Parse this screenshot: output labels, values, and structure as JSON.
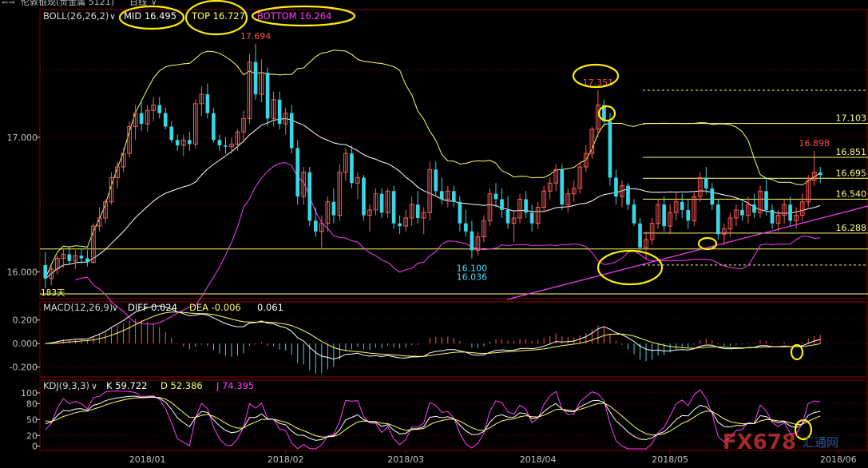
{
  "window": {
    "title": "伦敦银现(贵金属 5121)",
    "timeframe": "日线",
    "dropdown_glyph": "∨"
  },
  "colors": {
    "background": "#000000",
    "up": "#ff5a5a",
    "down": "#39d6e6",
    "price_axis": "#c0c0c0",
    "grid": "#7a0000",
    "mid": "#ffffff",
    "top": "#ffff66",
    "bottom": "#ff3dff",
    "level": "#ffff66",
    "trendline": "#ff3dff",
    "highlight": "#ffee00",
    "label_yellow": "#ffff88",
    "label_cyan": "#3fe0ff",
    "label_red": "#ff4b4b"
  },
  "boll_header": {
    "name": "BOLL(26,26,2)",
    "mid": "MID 16.495",
    "top": "TOP 16.727",
    "bottom": "BOTTOM 16.264"
  },
  "macd_header": {
    "name": "MACD(12,26,9)",
    "diff": "DIFF 0.024",
    "dea": "DEA -0.006",
    "macd": "0.061"
  },
  "kdj_header": {
    "name": "KDJ(9,3,3)",
    "k": "K 59.722",
    "d": "D 52.386",
    "j": "J 74.395"
  },
  "price_axis_ticks": [
    "17.000",
    "16.000"
  ],
  "macd_axis_ticks": [
    "0.200",
    "0.000",
    "-0.200"
  ],
  "kdj_axis_ticks": [
    "100",
    "80",
    "50",
    "20",
    "0"
  ],
  "bottom_left_text": "183天",
  "watermark_text": "FX678",
  "watermark_sub": "汇通网",
  "x_axis_labels": [
    {
      "label": "2018/01",
      "bar": 17
    },
    {
      "label": "2018/02",
      "bar": 40
    },
    {
      "label": "2018/03",
      "bar": 60
    },
    {
      "label": "2018/04",
      "bar": 82
    },
    {
      "label": "2018/05",
      "bar": 104
    },
    {
      "label": "2018/06",
      "bar": 132
    }
  ],
  "annotations": [
    {
      "text": "17.694",
      "color_key": "label_red"
    },
    {
      "text": "17.351",
      "color_key": "label_red"
    },
    {
      "text": "16.898",
      "color_key": "label_red"
    },
    {
      "text": "16.100",
      "color_key": "label_cyan"
    },
    {
      "text": "16.036",
      "color_key": "label_cyan"
    }
  ],
  "chart_data": {
    "type": "candlestick",
    "instrument": "伦敦银现",
    "period": "日线",
    "ylim": [
      15.8,
      17.95
    ],
    "horizontal_levels": [
      {
        "value": 17.103,
        "label": "17.103",
        "style": "solid"
      },
      {
        "value": 16.851,
        "label": "16.851",
        "style": "solid"
      },
      {
        "value": 16.695,
        "label": "16.695",
        "style": "solid"
      },
      {
        "value": 16.54,
        "label": "16.540",
        "style": "solid"
      },
      {
        "value": 16.288,
        "label": "16.288",
        "style": "solid"
      },
      {
        "value": 17.35,
        "label": "",
        "style": "dashed"
      },
      {
        "value": 16.05,
        "label": "",
        "style": "dashed"
      },
      {
        "value": 16.17,
        "label": "",
        "style": "solid_full"
      }
    ],
    "candles": [
      {
        "o": 16.05,
        "h": 16.15,
        "l": 15.88,
        "c": 15.95
      },
      {
        "o": 15.95,
        "h": 16.05,
        "l": 15.9,
        "c": 16.02
      },
      {
        "o": 16.02,
        "h": 16.12,
        "l": 15.98,
        "c": 16.1
      },
      {
        "o": 16.1,
        "h": 16.17,
        "l": 16.03,
        "c": 16.13
      },
      {
        "o": 16.13,
        "h": 16.19,
        "l": 16.05,
        "c": 16.08
      },
      {
        "o": 16.08,
        "h": 16.16,
        "l": 16.02,
        "c": 16.12
      },
      {
        "o": 16.12,
        "h": 16.17,
        "l": 16.06,
        "c": 16.1
      },
      {
        "o": 16.1,
        "h": 16.16,
        "l": 16.04,
        "c": 16.07
      },
      {
        "o": 16.07,
        "h": 16.36,
        "l": 16.06,
        "c": 16.34
      },
      {
        "o": 16.34,
        "h": 16.48,
        "l": 16.3,
        "c": 16.4
      },
      {
        "o": 16.4,
        "h": 16.54,
        "l": 16.36,
        "c": 16.52
      },
      {
        "o": 16.52,
        "h": 16.74,
        "l": 16.5,
        "c": 16.7
      },
      {
        "o": 16.7,
        "h": 16.82,
        "l": 16.62,
        "c": 16.78
      },
      {
        "o": 16.78,
        "h": 16.92,
        "l": 16.74,
        "c": 16.88
      },
      {
        "o": 16.88,
        "h": 17.12,
        "l": 16.85,
        "c": 17.08
      },
      {
        "o": 17.08,
        "h": 17.24,
        "l": 16.98,
        "c": 17.18
      },
      {
        "o": 17.18,
        "h": 17.26,
        "l": 17.05,
        "c": 17.1
      },
      {
        "o": 17.1,
        "h": 17.24,
        "l": 17.04,
        "c": 17.2
      },
      {
        "o": 17.2,
        "h": 17.3,
        "l": 17.12,
        "c": 17.24
      },
      {
        "o": 17.24,
        "h": 17.3,
        "l": 17.14,
        "c": 17.18
      },
      {
        "o": 17.18,
        "h": 17.22,
        "l": 17.06,
        "c": 17.08
      },
      {
        "o": 17.08,
        "h": 17.12,
        "l": 16.96,
        "c": 16.98
      },
      {
        "o": 16.98,
        "h": 17.02,
        "l": 16.9,
        "c": 16.94
      },
      {
        "o": 16.94,
        "h": 17.02,
        "l": 16.86,
        "c": 16.98
      },
      {
        "o": 16.98,
        "h": 17.04,
        "l": 16.9,
        "c": 16.95
      },
      {
        "o": 16.95,
        "h": 17.28,
        "l": 16.92,
        "c": 17.25
      },
      {
        "o": 17.25,
        "h": 17.38,
        "l": 17.16,
        "c": 17.32
      },
      {
        "o": 17.32,
        "h": 17.4,
        "l": 17.14,
        "c": 17.18
      },
      {
        "o": 17.18,
        "h": 17.22,
        "l": 16.96,
        "c": 16.98
      },
      {
        "o": 16.98,
        "h": 17.02,
        "l": 16.9,
        "c": 16.94
      },
      {
        "o": 16.94,
        "h": 17.0,
        "l": 16.88,
        "c": 16.93
      },
      {
        "o": 16.93,
        "h": 17.0,
        "l": 16.88,
        "c": 16.95
      },
      {
        "o": 16.95,
        "h": 17.06,
        "l": 16.9,
        "c": 17.04
      },
      {
        "o": 17.04,
        "h": 17.2,
        "l": 16.96,
        "c": 17.14
      },
      {
        "o": 17.14,
        "h": 17.62,
        "l": 17.1,
        "c": 17.56
      },
      {
        "o": 17.56,
        "h": 17.694,
        "l": 17.28,
        "c": 17.32
      },
      {
        "o": 17.32,
        "h": 17.58,
        "l": 17.26,
        "c": 17.48
      },
      {
        "o": 17.48,
        "h": 17.52,
        "l": 17.08,
        "c": 17.14
      },
      {
        "o": 17.14,
        "h": 17.34,
        "l": 17.08,
        "c": 17.28
      },
      {
        "o": 17.28,
        "h": 17.34,
        "l": 17.06,
        "c": 17.1
      },
      {
        "o": 17.1,
        "h": 17.22,
        "l": 17.02,
        "c": 17.18
      },
      {
        "o": 17.18,
        "h": 17.24,
        "l": 16.88,
        "c": 16.92
      },
      {
        "o": 16.92,
        "h": 16.98,
        "l": 16.5,
        "c": 16.56
      },
      {
        "o": 16.56,
        "h": 16.78,
        "l": 16.5,
        "c": 16.74
      },
      {
        "o": 16.74,
        "h": 16.78,
        "l": 16.34,
        "c": 16.38
      },
      {
        "o": 16.38,
        "h": 16.48,
        "l": 16.26,
        "c": 16.3
      },
      {
        "o": 16.3,
        "h": 16.42,
        "l": 16.18,
        "c": 16.36
      },
      {
        "o": 16.36,
        "h": 16.56,
        "l": 16.3,
        "c": 16.52
      },
      {
        "o": 16.52,
        "h": 16.62,
        "l": 16.36,
        "c": 16.42
      },
      {
        "o": 16.42,
        "h": 16.8,
        "l": 16.38,
        "c": 16.74
      },
      {
        "o": 16.74,
        "h": 16.92,
        "l": 16.68,
        "c": 16.88
      },
      {
        "o": 16.88,
        "h": 16.94,
        "l": 16.62,
        "c": 16.66
      },
      {
        "o": 16.66,
        "h": 16.74,
        "l": 16.54,
        "c": 16.7
      },
      {
        "o": 16.7,
        "h": 16.72,
        "l": 16.38,
        "c": 16.42
      },
      {
        "o": 16.42,
        "h": 16.5,
        "l": 16.3,
        "c": 16.46
      },
      {
        "o": 16.46,
        "h": 16.62,
        "l": 16.42,
        "c": 16.58
      },
      {
        "o": 16.58,
        "h": 16.62,
        "l": 16.4,
        "c": 16.44
      },
      {
        "o": 16.44,
        "h": 16.62,
        "l": 16.4,
        "c": 16.6
      },
      {
        "o": 16.6,
        "h": 16.64,
        "l": 16.32,
        "c": 16.36
      },
      {
        "o": 16.36,
        "h": 16.42,
        "l": 16.28,
        "c": 16.34
      },
      {
        "o": 16.34,
        "h": 16.46,
        "l": 16.3,
        "c": 16.4
      },
      {
        "o": 16.4,
        "h": 16.56,
        "l": 16.34,
        "c": 16.5
      },
      {
        "o": 16.5,
        "h": 16.6,
        "l": 16.36,
        "c": 16.4
      },
      {
        "o": 16.4,
        "h": 16.48,
        "l": 16.28,
        "c": 16.44
      },
      {
        "o": 16.44,
        "h": 16.82,
        "l": 16.38,
        "c": 16.76
      },
      {
        "o": 16.76,
        "h": 16.82,
        "l": 16.56,
        "c": 16.6
      },
      {
        "o": 16.6,
        "h": 16.7,
        "l": 16.5,
        "c": 16.54
      },
      {
        "o": 16.54,
        "h": 16.64,
        "l": 16.48,
        "c": 16.6
      },
      {
        "o": 16.6,
        "h": 16.64,
        "l": 16.48,
        "c": 16.52
      },
      {
        "o": 16.52,
        "h": 16.56,
        "l": 16.3,
        "c": 16.36
      },
      {
        "o": 16.36,
        "h": 16.46,
        "l": 16.26,
        "c": 16.3
      },
      {
        "o": 16.3,
        "h": 16.38,
        "l": 16.1,
        "c": 16.16
      },
      {
        "o": 16.16,
        "h": 16.3,
        "l": 16.12,
        "c": 16.26
      },
      {
        "o": 16.26,
        "h": 16.42,
        "l": 16.22,
        "c": 16.38
      },
      {
        "o": 16.38,
        "h": 16.62,
        "l": 16.34,
        "c": 16.58
      },
      {
        "o": 16.58,
        "h": 16.66,
        "l": 16.48,
        "c": 16.54
      },
      {
        "o": 16.54,
        "h": 16.62,
        "l": 16.4,
        "c": 16.46
      },
      {
        "o": 16.46,
        "h": 16.56,
        "l": 16.32,
        "c": 16.36
      },
      {
        "o": 16.36,
        "h": 16.46,
        "l": 16.22,
        "c": 16.4
      },
      {
        "o": 16.4,
        "h": 16.58,
        "l": 16.36,
        "c": 16.54
      },
      {
        "o": 16.54,
        "h": 16.6,
        "l": 16.4,
        "c": 16.44
      },
      {
        "o": 16.44,
        "h": 16.5,
        "l": 16.3,
        "c": 16.36
      },
      {
        "o": 16.36,
        "h": 16.52,
        "l": 16.32,
        "c": 16.48
      },
      {
        "o": 16.48,
        "h": 16.64,
        "l": 16.44,
        "c": 16.6
      },
      {
        "o": 16.6,
        "h": 16.7,
        "l": 16.54,
        "c": 16.66
      },
      {
        "o": 16.66,
        "h": 16.8,
        "l": 16.6,
        "c": 16.76
      },
      {
        "o": 16.76,
        "h": 16.8,
        "l": 16.46,
        "c": 16.5
      },
      {
        "o": 16.5,
        "h": 16.62,
        "l": 16.44,
        "c": 16.58
      },
      {
        "o": 16.58,
        "h": 16.68,
        "l": 16.52,
        "c": 16.62
      },
      {
        "o": 16.62,
        "h": 16.82,
        "l": 16.58,
        "c": 16.78
      },
      {
        "o": 16.78,
        "h": 16.94,
        "l": 16.74,
        "c": 16.88
      },
      {
        "o": 16.88,
        "h": 17.08,
        "l": 16.84,
        "c": 17.06
      },
      {
        "o": 17.06,
        "h": 17.351,
        "l": 17.0,
        "c": 17.24
      },
      {
        "o": 17.24,
        "h": 17.28,
        "l": 17.08,
        "c": 17.12
      },
      {
        "o": 17.12,
        "h": 17.18,
        "l": 16.64,
        "c": 16.7
      },
      {
        "o": 16.7,
        "h": 16.76,
        "l": 16.5,
        "c": 16.56
      },
      {
        "o": 16.56,
        "h": 16.68,
        "l": 16.48,
        "c": 16.64
      },
      {
        "o": 16.64,
        "h": 16.66,
        "l": 16.46,
        "c": 16.5
      },
      {
        "o": 16.5,
        "h": 16.54,
        "l": 16.34,
        "c": 16.36
      },
      {
        "o": 16.36,
        "h": 16.4,
        "l": 16.15,
        "c": 16.18
      },
      {
        "o": 16.18,
        "h": 16.3,
        "l": 16.1,
        "c": 16.24
      },
      {
        "o": 16.24,
        "h": 16.4,
        "l": 16.2,
        "c": 16.36
      },
      {
        "o": 16.36,
        "h": 16.54,
        "l": 16.32,
        "c": 16.5
      },
      {
        "o": 16.5,
        "h": 16.56,
        "l": 16.3,
        "c": 16.34
      },
      {
        "o": 16.34,
        "h": 16.5,
        "l": 16.28,
        "c": 16.44
      },
      {
        "o": 16.44,
        "h": 16.6,
        "l": 16.38,
        "c": 16.52
      },
      {
        "o": 16.52,
        "h": 16.58,
        "l": 16.4,
        "c": 16.46
      },
      {
        "o": 16.46,
        "h": 16.54,
        "l": 16.32,
        "c": 16.38
      },
      {
        "o": 16.38,
        "h": 16.6,
        "l": 16.34,
        "c": 16.56
      },
      {
        "o": 16.56,
        "h": 16.74,
        "l": 16.52,
        "c": 16.7
      },
      {
        "o": 16.7,
        "h": 16.78,
        "l": 16.58,
        "c": 16.62
      },
      {
        "o": 16.62,
        "h": 16.66,
        "l": 16.46,
        "c": 16.5
      },
      {
        "o": 16.5,
        "h": 16.54,
        "l": 16.24,
        "c": 16.28
      },
      {
        "o": 16.28,
        "h": 16.36,
        "l": 16.2,
        "c": 16.32
      },
      {
        "o": 16.32,
        "h": 16.44,
        "l": 16.26,
        "c": 16.4
      },
      {
        "o": 16.4,
        "h": 16.5,
        "l": 16.34,
        "c": 16.46
      },
      {
        "o": 16.46,
        "h": 16.52,
        "l": 16.38,
        "c": 16.42
      },
      {
        "o": 16.42,
        "h": 16.56,
        "l": 16.36,
        "c": 16.5
      },
      {
        "o": 16.5,
        "h": 16.58,
        "l": 16.4,
        "c": 16.44
      },
      {
        "o": 16.44,
        "h": 16.64,
        "l": 16.4,
        "c": 16.6
      },
      {
        "o": 16.6,
        "h": 16.7,
        "l": 16.42,
        "c": 16.46
      },
      {
        "o": 16.46,
        "h": 16.5,
        "l": 16.32,
        "c": 16.36
      },
      {
        "o": 16.36,
        "h": 16.46,
        "l": 16.3,
        "c": 16.42
      },
      {
        "o": 16.42,
        "h": 16.54,
        "l": 16.36,
        "c": 16.5
      },
      {
        "o": 16.5,
        "h": 16.56,
        "l": 16.34,
        "c": 16.38
      },
      {
        "o": 16.38,
        "h": 16.48,
        "l": 16.32,
        "c": 16.42
      },
      {
        "o": 16.42,
        "h": 16.58,
        "l": 16.38,
        "c": 16.52
      },
      {
        "o": 16.52,
        "h": 16.72,
        "l": 16.48,
        "c": 16.68
      },
      {
        "o": 16.68,
        "h": 16.898,
        "l": 16.64,
        "c": 16.74
      },
      {
        "o": 16.74,
        "h": 16.78,
        "l": 16.66,
        "c": 16.72
      }
    ],
    "macd_ylim": [
      -0.27,
      0.3
    ],
    "kdj_ylim": [
      -5,
      112
    ]
  }
}
